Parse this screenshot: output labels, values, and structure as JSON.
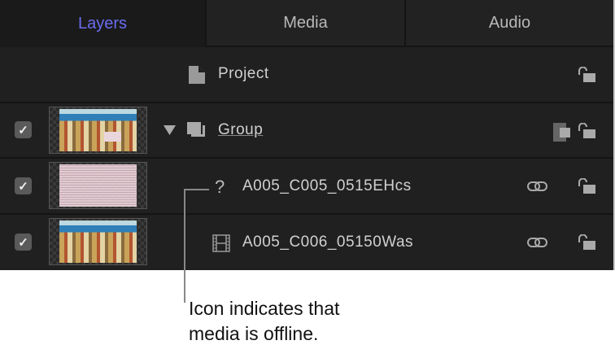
{
  "tabs": [
    {
      "label": "Layers",
      "active": true
    },
    {
      "label": "Media",
      "active": false
    },
    {
      "label": "Audio",
      "active": false
    }
  ],
  "project": {
    "label": "Project"
  },
  "layers": [
    {
      "name": "Group",
      "checked": true,
      "type": "group"
    },
    {
      "name": "A005_C005_0515EHcs",
      "checked": true,
      "type": "offline",
      "status_icon": "?"
    },
    {
      "name": "A005_C006_05150Was",
      "checked": true,
      "type": "video"
    }
  ],
  "checkmark": "✓",
  "callout": {
    "line1": "Icon indicates that",
    "line2": "media is offline."
  },
  "colors": {
    "accent": "#6a6cf0",
    "panel": "#202020"
  }
}
